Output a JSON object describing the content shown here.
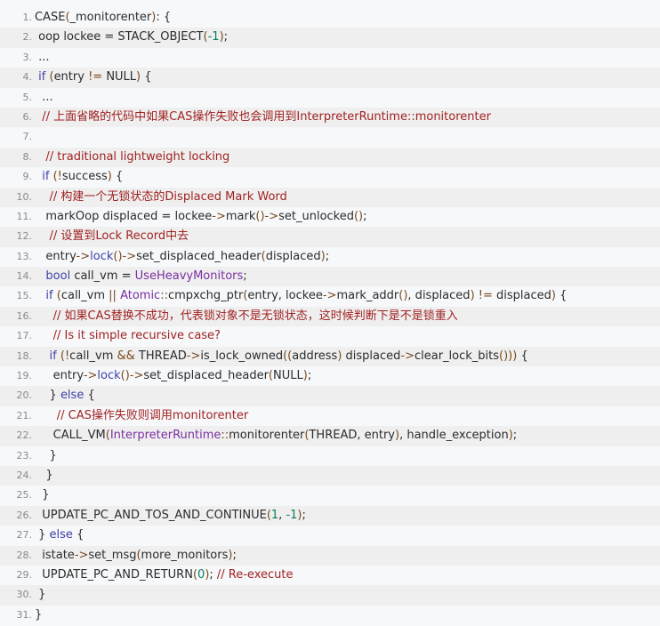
{
  "colors": {
    "background": "#f6f8fa",
    "even_row": "#efefef",
    "line_number": "#8a8a8a",
    "plain": "#2b2b2b",
    "keyword": "#3f3fa8",
    "number": "#0b7d5b",
    "operator": "#7a4a1c",
    "comment": "#a12222",
    "type": "#7a2fa0"
  },
  "lines": [
    {
      "n": "1.",
      "segs": [
        [
          "plain",
          "CASE"
        ],
        [
          "op",
          "("
        ],
        [
          "plain",
          "_monitorenter"
        ],
        [
          "op",
          ")"
        ],
        [
          "plain",
          ": {"
        ]
      ]
    },
    {
      "n": "2.",
      "segs": [
        [
          "plain",
          " oop lockee = STACK_OBJECT"
        ],
        [
          "op",
          "("
        ],
        [
          "num",
          "-1"
        ],
        [
          "op",
          ")"
        ],
        [
          "plain",
          ";"
        ]
      ]
    },
    {
      "n": "3.",
      "segs": [
        [
          "plain",
          " ..."
        ]
      ]
    },
    {
      "n": "4.",
      "segs": [
        [
          "plain",
          " "
        ],
        [
          "kw",
          "if"
        ],
        [
          "plain",
          " "
        ],
        [
          "op",
          "("
        ],
        [
          "plain",
          "entry "
        ],
        [
          "op",
          "!="
        ],
        [
          "plain",
          " NULL"
        ],
        [
          "op",
          ")"
        ],
        [
          "plain",
          " {"
        ]
      ]
    },
    {
      "n": "5.",
      "segs": [
        [
          "plain",
          "  ..."
        ]
      ]
    },
    {
      "n": "6.",
      "segs": [
        [
          "cm",
          "  // 上面省略的代码中如果CAS操作失败也会调用到InterpreterRuntime::monitorenter"
        ]
      ]
    },
    {
      "n": "7.",
      "segs": [
        [
          "plain",
          ""
        ]
      ]
    },
    {
      "n": "8.",
      "segs": [
        [
          "cm",
          "   // traditional lightweight locking"
        ]
      ]
    },
    {
      "n": "9.",
      "segs": [
        [
          "plain",
          "  "
        ],
        [
          "kw",
          "if"
        ],
        [
          "plain",
          " "
        ],
        [
          "op",
          "(!"
        ],
        [
          "plain",
          "success"
        ],
        [
          "op",
          ")"
        ],
        [
          "plain",
          " {"
        ]
      ]
    },
    {
      "n": "10.",
      "segs": [
        [
          "cm",
          "    // 构建一个无锁状态的Displaced Mark Word"
        ]
      ]
    },
    {
      "n": "11.",
      "segs": [
        [
          "plain",
          "   markOop displaced = lockee"
        ],
        [
          "op",
          "->"
        ],
        [
          "plain",
          "mark"
        ],
        [
          "op",
          "()->"
        ],
        [
          "plain",
          "set_unlocked"
        ],
        [
          "op",
          "()"
        ],
        [
          "plain",
          ";"
        ]
      ]
    },
    {
      "n": "12.",
      "segs": [
        [
          "cm",
          "    // 设置到Lock Record中去"
        ]
      ]
    },
    {
      "n": "13.",
      "segs": [
        [
          "plain",
          "   entry"
        ],
        [
          "op",
          "->"
        ],
        [
          "kw",
          "lock"
        ],
        [
          "op",
          "()->"
        ],
        [
          "plain",
          "set_displaced_header"
        ],
        [
          "op",
          "("
        ],
        [
          "plain",
          "displaced"
        ],
        [
          "op",
          ")"
        ],
        [
          "plain",
          ";"
        ]
      ]
    },
    {
      "n": "14.",
      "segs": [
        [
          "plain",
          "   "
        ],
        [
          "kw",
          "bool"
        ],
        [
          "plain",
          " call_vm = "
        ],
        [
          "type",
          "UseHeavyMonitors"
        ],
        [
          "plain",
          ";"
        ]
      ]
    },
    {
      "n": "15.",
      "segs": [
        [
          "plain",
          "   "
        ],
        [
          "kw",
          "if"
        ],
        [
          "plain",
          " "
        ],
        [
          "op",
          "("
        ],
        [
          "plain",
          "call_vm "
        ],
        [
          "op",
          "||"
        ],
        [
          "plain",
          " "
        ],
        [
          "type",
          "Atomic"
        ],
        [
          "op",
          "::"
        ],
        [
          "plain",
          "cmpxchg_ptr"
        ],
        [
          "op",
          "("
        ],
        [
          "plain",
          "entry, lockee"
        ],
        [
          "op",
          "->"
        ],
        [
          "plain",
          "mark_addr"
        ],
        [
          "op",
          "()"
        ],
        [
          "plain",
          ", displaced"
        ],
        [
          "op",
          ")"
        ],
        [
          "plain",
          " "
        ],
        [
          "op",
          "!="
        ],
        [
          "plain",
          " displaced"
        ],
        [
          "op",
          ")"
        ],
        [
          "plain",
          " {"
        ]
      ]
    },
    {
      "n": "16.",
      "segs": [
        [
          "cm",
          "     // 如果CAS替换不成功，代表锁对象不是无锁状态，这时候判断下是不是锁重入"
        ]
      ]
    },
    {
      "n": "17.",
      "segs": [
        [
          "cm",
          "     // Is it simple recursive case?"
        ]
      ]
    },
    {
      "n": "18.",
      "segs": [
        [
          "plain",
          "    "
        ],
        [
          "kw",
          "if"
        ],
        [
          "plain",
          " "
        ],
        [
          "op",
          "(!"
        ],
        [
          "plain",
          "call_vm "
        ],
        [
          "op",
          "&&"
        ],
        [
          "plain",
          " THREAD"
        ],
        [
          "op",
          "->"
        ],
        [
          "plain",
          "is_lock_owned"
        ],
        [
          "op",
          "(("
        ],
        [
          "plain",
          "address"
        ],
        [
          "op",
          ")"
        ],
        [
          "plain",
          " displaced"
        ],
        [
          "op",
          "->"
        ],
        [
          "plain",
          "clear_lock_bits"
        ],
        [
          "op",
          "()))"
        ],
        [
          "plain",
          " {"
        ]
      ]
    },
    {
      "n": "19.",
      "segs": [
        [
          "plain",
          "     entry"
        ],
        [
          "op",
          "->"
        ],
        [
          "kw",
          "lock"
        ],
        [
          "op",
          "()->"
        ],
        [
          "plain",
          "set_displaced_header"
        ],
        [
          "op",
          "("
        ],
        [
          "plain",
          "NULL"
        ],
        [
          "op",
          ")"
        ],
        [
          "plain",
          ";"
        ]
      ]
    },
    {
      "n": "20.",
      "segs": [
        [
          "plain",
          "    } "
        ],
        [
          "kw",
          "else"
        ],
        [
          "plain",
          " {"
        ]
      ]
    },
    {
      "n": "21.",
      "segs": [
        [
          "cm",
          "      // CAS操作失败则调用monitorenter"
        ]
      ]
    },
    {
      "n": "22.",
      "segs": [
        [
          "plain",
          "     CALL_VM"
        ],
        [
          "op",
          "("
        ],
        [
          "type",
          "InterpreterRuntime"
        ],
        [
          "op",
          "::"
        ],
        [
          "plain",
          "monitorenter"
        ],
        [
          "op",
          "("
        ],
        [
          "plain",
          "THREAD, entry"
        ],
        [
          "op",
          ")"
        ],
        [
          "plain",
          ", handle_exception"
        ],
        [
          "op",
          ")"
        ],
        [
          "plain",
          ";"
        ]
      ]
    },
    {
      "n": "23.",
      "segs": [
        [
          "plain",
          "    }"
        ]
      ]
    },
    {
      "n": "24.",
      "segs": [
        [
          "plain",
          "   }"
        ]
      ]
    },
    {
      "n": "25.",
      "segs": [
        [
          "plain",
          "  }"
        ]
      ]
    },
    {
      "n": "26.",
      "segs": [
        [
          "plain",
          "  UPDATE_PC_AND_TOS_AND_CONTINUE"
        ],
        [
          "op",
          "("
        ],
        [
          "num",
          "1"
        ],
        [
          "plain",
          ", "
        ],
        [
          "num",
          "-1"
        ],
        [
          "op",
          ")"
        ],
        [
          "plain",
          ";"
        ]
      ]
    },
    {
      "n": "27.",
      "segs": [
        [
          "plain",
          " } "
        ],
        [
          "kw",
          "else"
        ],
        [
          "plain",
          " {"
        ]
      ]
    },
    {
      "n": "28.",
      "segs": [
        [
          "plain",
          "  istate"
        ],
        [
          "op",
          "->"
        ],
        [
          "plain",
          "set_msg"
        ],
        [
          "op",
          "("
        ],
        [
          "plain",
          "more_monitors"
        ],
        [
          "op",
          ")"
        ],
        [
          "plain",
          ";"
        ]
      ]
    },
    {
      "n": "29.",
      "segs": [
        [
          "plain",
          "  UPDATE_PC_AND_RETURN"
        ],
        [
          "op",
          "("
        ],
        [
          "num",
          "0"
        ],
        [
          "op",
          ")"
        ],
        [
          "plain",
          "; "
        ],
        [
          "cm",
          "// Re-execute"
        ]
      ]
    },
    {
      "n": "30.",
      "segs": [
        [
          "plain",
          " }"
        ]
      ]
    },
    {
      "n": "31.",
      "segs": [
        [
          "plain",
          "}"
        ]
      ]
    }
  ]
}
